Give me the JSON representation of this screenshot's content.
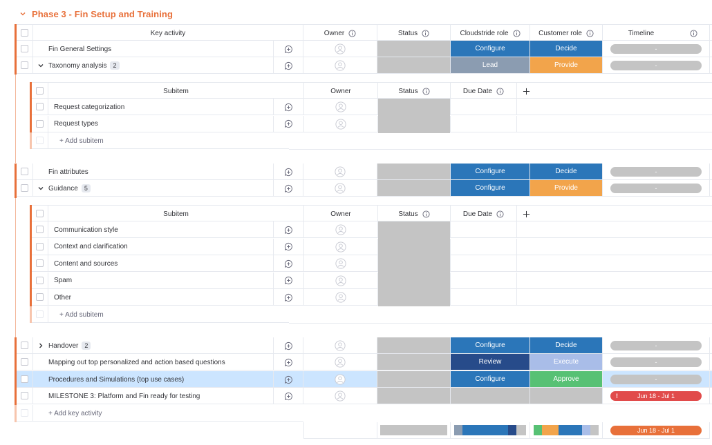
{
  "phase": {
    "title": "Phase 3 - Fin Setup and Training"
  },
  "colors": {
    "accent": "#e8703a",
    "configure": "#2b76b9",
    "decide": "#2b76b9",
    "lead": "#8b9cb1",
    "provide": "#f2a44b",
    "review": "#274b8a",
    "execute": "#a9bde8",
    "approve": "#57c174",
    "status_empty": "#c4c4c4",
    "milestone": "#e14b4b"
  },
  "columns": {
    "key_activity": "Key activity",
    "owner": "Owner",
    "status": "Status",
    "cloudstride_role": "Cloudstride role",
    "customer_role": "Customer role",
    "timeline": "Timeline"
  },
  "sub_columns": {
    "subitem": "Subitem",
    "owner": "Owner",
    "status": "Status",
    "due_date": "Due Date"
  },
  "rows": [
    {
      "name": "Fin General Settings",
      "cloud_role": "Configure",
      "cust_role": "Decide",
      "timeline": "-"
    },
    {
      "name": "Taxonomy analysis",
      "count": "2",
      "cloud_role": "Lead",
      "cust_role": "Provide",
      "timeline": "-"
    },
    {
      "name": "Fin attributes",
      "cloud_role": "Configure",
      "cust_role": "Decide",
      "timeline": "-"
    },
    {
      "name": "Guidance",
      "count": "5",
      "cloud_role": "Configure",
      "cust_role": "Provide",
      "timeline": "-"
    },
    {
      "name": "Handover",
      "count": "2",
      "cloud_role": "Configure",
      "cust_role": "Decide",
      "timeline": "-"
    },
    {
      "name": "Mapping out top personalized and action based questions",
      "cloud_role": "Review",
      "cust_role": "Execute",
      "timeline": "-"
    },
    {
      "name": "Procedures and Simulations (top use cases)",
      "cloud_role": "Configure",
      "cust_role": "Approve",
      "timeline": "-"
    },
    {
      "name": "MILESTONE 3: Platform and Fin ready for testing",
      "cloud_role": "",
      "cust_role": "",
      "timeline": "Jun 18 - Jul 1",
      "alert": "!"
    }
  ],
  "subitems_taxonomy": [
    {
      "name": "Request categorization"
    },
    {
      "name": "Request types"
    }
  ],
  "subitems_guidance": [
    {
      "name": "Communication style"
    },
    {
      "name": "Context and clarification"
    },
    {
      "name": "Content and sources"
    },
    {
      "name": "Spam"
    },
    {
      "name": "Other"
    }
  ],
  "actions": {
    "add_subitem": "+ Add subitem",
    "add_key_activity": "+ Add key activity"
  },
  "summary": {
    "timeline": "Jun 18 - Jul 1"
  }
}
